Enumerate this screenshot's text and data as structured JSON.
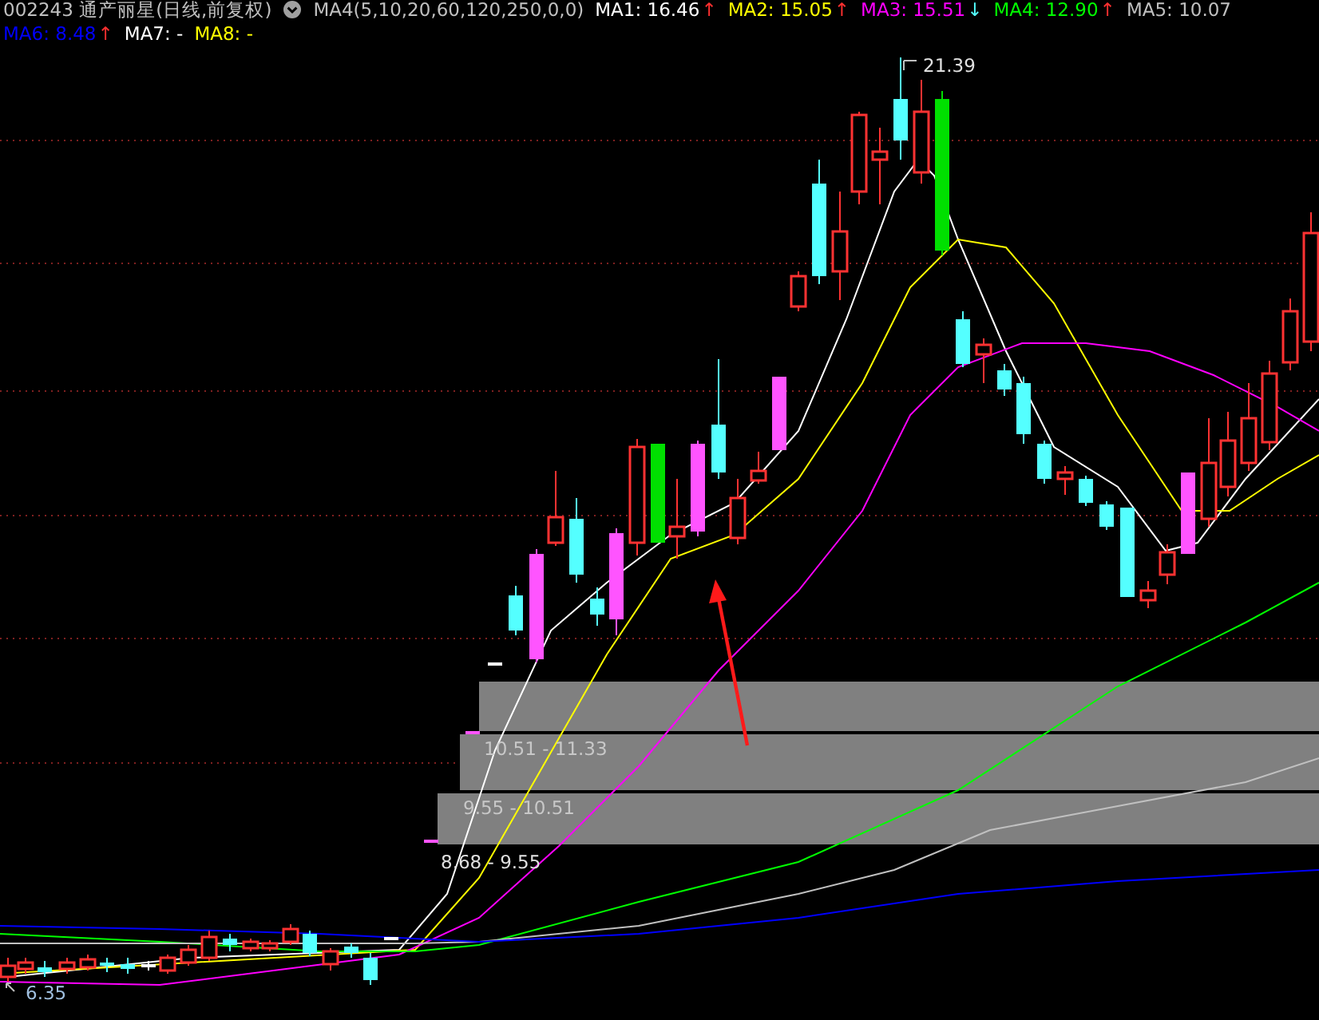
{
  "header": {
    "code": "002243",
    "name": "通产丽星(日线,前复权)",
    "params": "MA4(5,10,20,60,120,250,0,0)",
    "averages": [
      {
        "label": "MA1: 16.46",
        "color": "#ffffff",
        "arrow": {
          "glyph": "↑",
          "color": "#ff3030"
        }
      },
      {
        "label": "MA2: 15.05",
        "color": "#ffff00",
        "arrow": {
          "glyph": "↑",
          "color": "#ff3030"
        }
      },
      {
        "label": "MA3: 15.51",
        "color": "#ff00ff",
        "arrow": {
          "glyph": "↓",
          "color": "#54ffff"
        }
      },
      {
        "label": "MA4: 12.90",
        "color": "#00ff00",
        "arrow": {
          "glyph": "↑",
          "color": "#ff3030"
        }
      },
      {
        "label": "MA5: 10.07",
        "color": "#c0c0c0"
      },
      {
        "label": "MA6: 8.48",
        "color": "#0000ff",
        "arrow": {
          "glyph": "↑",
          "color": "#ff3030"
        }
      },
      {
        "label": "MA7: -",
        "color": "#ffffff"
      },
      {
        "label": "MA8: -",
        "color": "#ffff00"
      }
    ]
  },
  "chart": {
    "high_label": "21.39",
    "low_label": "6.35",
    "price_zones": [
      {
        "label": "10.51 - 11.33"
      },
      {
        "label": "9.55 - 10.51"
      },
      {
        "label": "8.68 - 9.55"
      }
    ]
  }
}
